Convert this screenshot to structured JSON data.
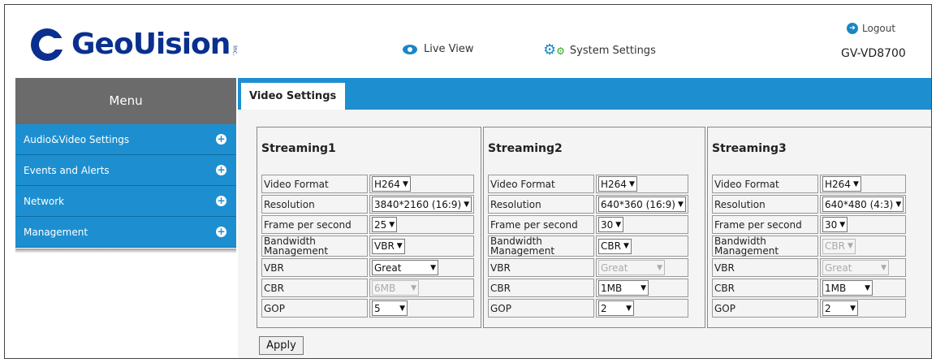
{
  "header": {
    "brand": "GeoUision",
    "brand_suffix": "Inc.",
    "nav": {
      "live_view": "Live View",
      "system_settings": "System Settings"
    },
    "logout": "Logout",
    "device_name": "GV-VD8700"
  },
  "sidebar": {
    "title": "Menu",
    "items": [
      {
        "label": "Audio&Video Settings"
      },
      {
        "label": "Events and Alerts"
      },
      {
        "label": "Network"
      },
      {
        "label": "Management"
      }
    ]
  },
  "main": {
    "tab": "Video Settings",
    "labels": {
      "video_format": "Video Format",
      "resolution": "Resolution",
      "fps": "Frame per second",
      "bandwidth_1": "Bandwidth",
      "bandwidth_2": "Management",
      "vbr": "VBR",
      "cbr": "CBR",
      "gop": "GOP"
    },
    "streams": [
      {
        "title": "Streaming1",
        "video_format": "H264",
        "resolution": "3840*2160 (16:9)",
        "fps": "25",
        "bandwidth": "VBR",
        "vbr": "Great",
        "cbr": "6MB",
        "gop": "5"
      },
      {
        "title": "Streaming2",
        "video_format": "H264",
        "resolution": "640*360 (16:9)",
        "fps": "30",
        "bandwidth": "CBR",
        "vbr": "Great",
        "cbr": "1MB",
        "gop": "2"
      },
      {
        "title": "Streaming3",
        "video_format": "H264",
        "resolution": "640*480 (4:3)",
        "fps": "30",
        "bandwidth": "CBR",
        "vbr": "Great",
        "cbr": "1MB",
        "gop": "2"
      }
    ],
    "apply_label": "Apply"
  },
  "colors": {
    "accent": "#1d8fd0",
    "menu_header": "#6b6b6b",
    "brand": "#0a2f8f"
  }
}
